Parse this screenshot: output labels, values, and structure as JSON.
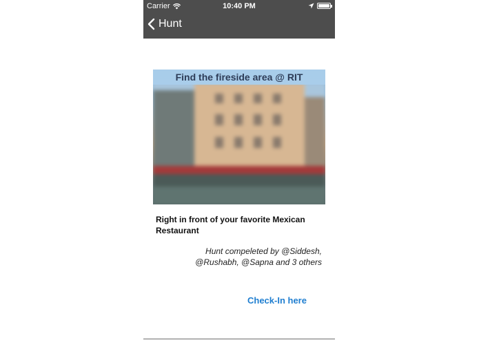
{
  "status_bar": {
    "carrier": "Carrier",
    "time": "10:40 PM",
    "battery_level": 1.0
  },
  "nav": {
    "back_label": "Hunt"
  },
  "hunt": {
    "title": "Find the fireside area @ RIT",
    "hint": "Right in front of your favorite Mexican Restaurant",
    "completed_line1": "Hunt compeleted by @Siddesh,",
    "completed_line2": "@Rushabh, @Sapna and 3 others",
    "checkin_label": "Check-In here"
  },
  "colors": {
    "navbar": "#4d4d4d",
    "link": "#1f7ed0",
    "banner": "#aacdeb"
  }
}
